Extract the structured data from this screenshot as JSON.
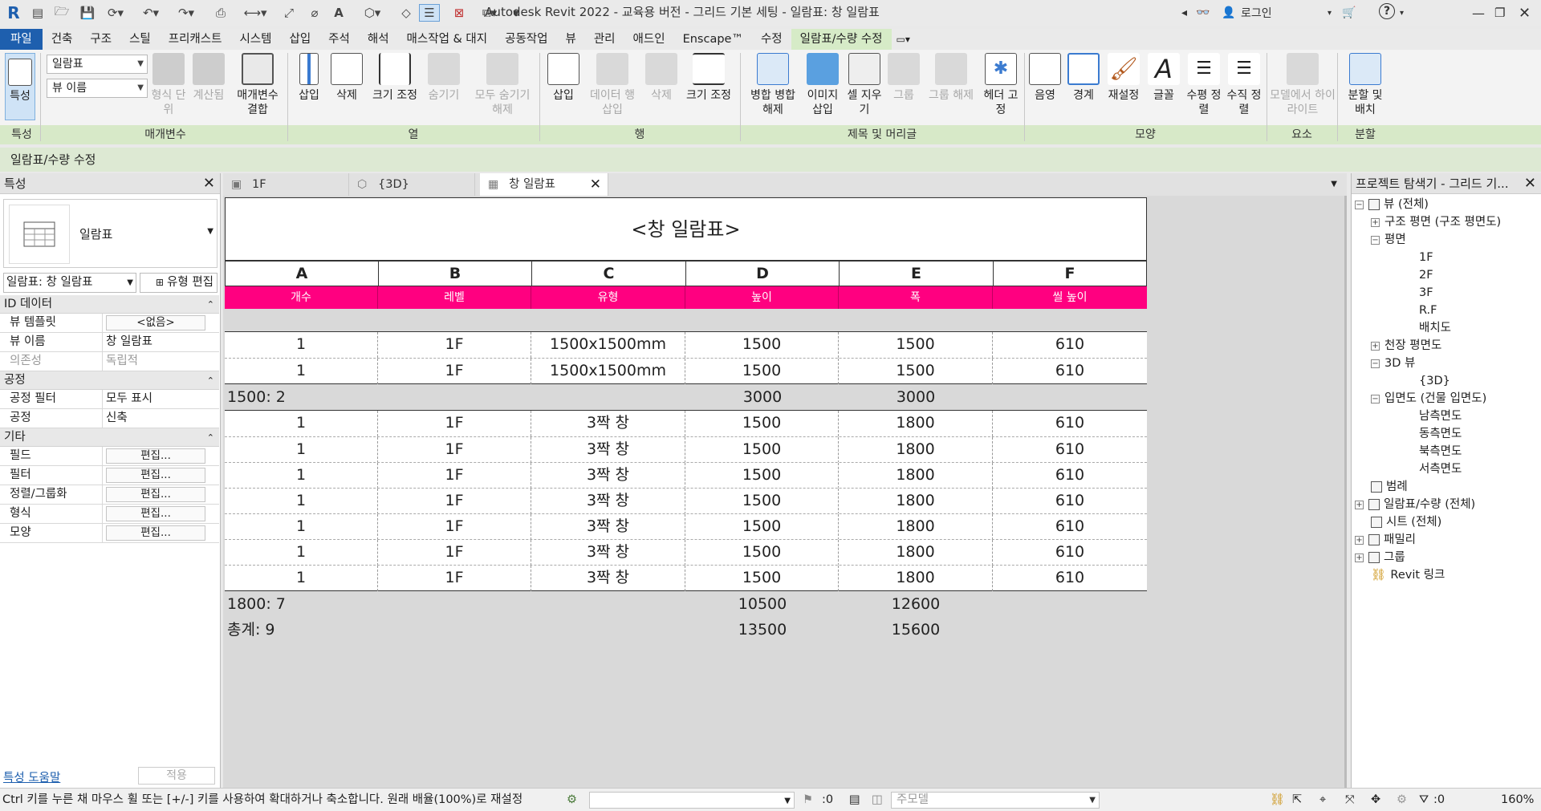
{
  "app_title": "Autodesk Revit 2022 - 교육용 버전 - 그리드 기본 세팅 - 일람표: 창 일람표",
  "topbar": {
    "login": "로그인",
    "help": "?"
  },
  "ribbon_tabs": [
    "파일",
    "건축",
    "구조",
    "스틸",
    "프리캐스트",
    "시스템",
    "삽입",
    "주석",
    "해석",
    "매스작업 & 대지",
    "공동작업",
    "뷰",
    "관리",
    "애드인",
    "Enscape™",
    "수정",
    "일람표/수량 수정"
  ],
  "ribbon": {
    "props_btn": "특성",
    "param_select": "일람표",
    "view_name_select": "뷰 이름",
    "btn_format_unit": "형식 단위",
    "btn_calc": "계산됨",
    "btn_combine_params": "매개변수 결합",
    "btn_col_insert": "삽입",
    "btn_col_delete": "삭제",
    "btn_col_resize": "크기 조정",
    "btn_col_hide": "숨기기",
    "btn_col_unhide": "모두 숨기기 해제",
    "btn_row_insert": "삽입",
    "btn_row_insert_data": "데이터 행 삽입",
    "btn_row_delete": "삭제",
    "btn_row_resize": "크기 조정",
    "btn_merge": "병합 병합 해제",
    "btn_insert_image": "이미지 삽입",
    "btn_clear_cell": "셀 지우기",
    "btn_group": "그룹",
    "btn_ungroup": "그룹 해제",
    "btn_freeze_header": "헤더 고정",
    "btn_shading": "음영",
    "btn_borders": "경계",
    "btn_reset": "재설정",
    "btn_font": "글꼴",
    "btn_halign": "수평 정렬",
    "btn_valign": "수직 정렬",
    "btn_highlight_model": "모델에서 하이라이트",
    "btn_split_place": "분할 및 배치",
    "groups": {
      "props": "특성",
      "params": "매개변수",
      "columns": "열",
      "rows": "행",
      "titles": "제목 및 머리글",
      "appearance": "모양",
      "element": "요소",
      "split": "분할"
    }
  },
  "context_bar": "일람표/수량 수정",
  "properties": {
    "title": "특성",
    "type_name": "일람표",
    "instance_select": "일람표: 창 일람표",
    "edit_type": "유형 편집",
    "categories": {
      "identity": "ID 데이터",
      "phasing": "공정",
      "other": "기타"
    },
    "rows": {
      "view_template": {
        "k": "뷰 템플릿",
        "v": "<없음>"
      },
      "view_name": {
        "k": "뷰 이름",
        "v": "창 일람표"
      },
      "dependency": {
        "k": "의존성",
        "v": "독립적"
      },
      "phase_filter": {
        "k": "공정 필터",
        "v": "모두 표시"
      },
      "phase": {
        "k": "공정",
        "v": "신축"
      },
      "fields": {
        "k": "필드",
        "v": "편집..."
      },
      "filter": {
        "k": "필터",
        "v": "편집..."
      },
      "sorting": {
        "k": "정렬/그룹화",
        "v": "편집..."
      },
      "formatting": {
        "k": "형식",
        "v": "편집..."
      },
      "appearance": {
        "k": "모양",
        "v": "편집..."
      }
    },
    "help_link": "특성 도움말",
    "apply": "적용"
  },
  "view_tabs": [
    {
      "label": "1F"
    },
    {
      "label": "{3D}"
    },
    {
      "label": "창 일람표"
    }
  ],
  "schedule": {
    "title": "<창 일람표>",
    "columns": [
      "A",
      "B",
      "C",
      "D",
      "E",
      "F"
    ],
    "headers": [
      "개수",
      "레벨",
      "유형",
      "높이",
      "폭",
      "씰 높이"
    ],
    "group1_rows": [
      [
        "1",
        "1F",
        "1500x1500mm",
        "1500",
        "1500",
        "610"
      ],
      [
        "1",
        "1F",
        "1500x1500mm",
        "1500",
        "1500",
        "610"
      ]
    ],
    "group1_summary": {
      "label": "1500: 2",
      "d": "3000",
      "e": "3000"
    },
    "group2_rows": [
      [
        "1",
        "1F",
        "3짝 창",
        "1500",
        "1800",
        "610"
      ],
      [
        "1",
        "1F",
        "3짝 창",
        "1500",
        "1800",
        "610"
      ],
      [
        "1",
        "1F",
        "3짝 창",
        "1500",
        "1800",
        "610"
      ],
      [
        "1",
        "1F",
        "3짝 창",
        "1500",
        "1800",
        "610"
      ],
      [
        "1",
        "1F",
        "3짝 창",
        "1500",
        "1800",
        "610"
      ],
      [
        "1",
        "1F",
        "3짝 창",
        "1500",
        "1800",
        "610"
      ],
      [
        "1",
        "1F",
        "3짝 창",
        "1500",
        "1800",
        "610"
      ]
    ],
    "group2_summary": {
      "label": "1800: 7",
      "d": "10500",
      "e": "12600"
    },
    "grand_total": {
      "label": "총계: 9",
      "d": "13500",
      "e": "15600"
    }
  },
  "browser": {
    "title": "프로젝트 탐색기 - 그리드 기...",
    "nodes": {
      "views_all": "뷰 (전체)",
      "structural_plans": "구조 평면 (구조 평면도)",
      "floor_plans": "평면",
      "fp_1f": "1F",
      "fp_2f": "2F",
      "fp_3f": "3F",
      "fp_rf": "R.F",
      "fp_site": "배치도",
      "ceiling_plans": "천장 평면도",
      "views_3d": "3D 뷰",
      "v3d": "{3D}",
      "elevations": "입면도 (건물 입면도)",
      "el_south": "남측면도",
      "el_east": "동측면도",
      "el_north": "북측면도",
      "el_west": "서측면도",
      "legends": "범례",
      "schedules": "일람표/수량 (전체)",
      "sheets": "시트 (전체)",
      "families": "패밀리",
      "groups": "그룹",
      "revit_links": "Revit 링크"
    }
  },
  "status": {
    "message": "Ctrl 키를 누른 채 마우스 휠 또는 [+/-] 키를 사용하여 확대하거나 축소합니다. 원래 배율(100%)로 재설정",
    "workset_count": ":0",
    "model_select": "주모델",
    "filter_count": ":0",
    "zoom": "160%"
  },
  "colors": {
    "file_tab": "#1e5fae",
    "context_green": "#d6ebc7",
    "header_pink": "#ff0080"
  }
}
